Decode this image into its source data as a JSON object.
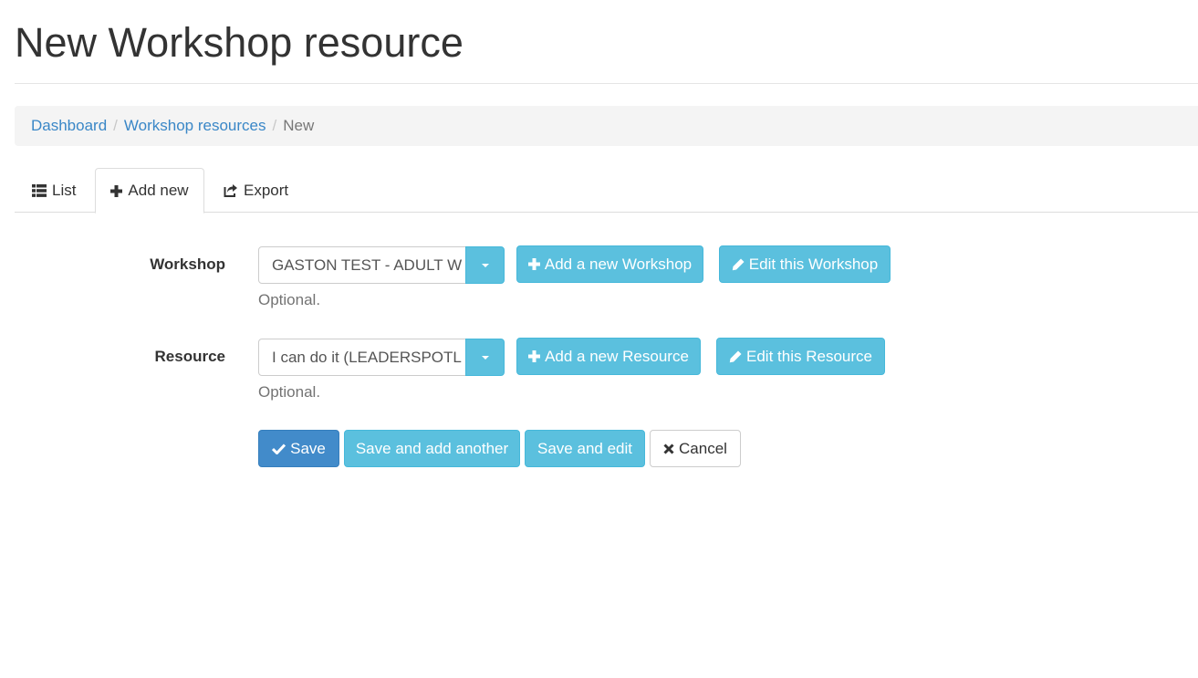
{
  "page": {
    "title": "New Workshop resource"
  },
  "breadcrumb": {
    "items": [
      {
        "label": "Dashboard"
      },
      {
        "label": "Workshop resources"
      },
      {
        "label": "New"
      }
    ],
    "separator": "/"
  },
  "tabs": [
    {
      "label": "List",
      "icon": "list-icon"
    },
    {
      "label": "Add new",
      "icon": "plus-icon",
      "active": true
    },
    {
      "label": "Export",
      "icon": "share-icon"
    }
  ],
  "form": {
    "workshop": {
      "label": "Workshop",
      "value": "GASTON TEST - ADULT W",
      "help": "Optional.",
      "add_label": "Add a new Workshop",
      "edit_label": "Edit this Workshop"
    },
    "resource": {
      "label": "Resource",
      "value": "I can do it (LEADERSPOTL",
      "help": "Optional.",
      "add_label": "Add a new Resource",
      "edit_label": "Edit this Resource"
    }
  },
  "actions": {
    "save": "Save",
    "save_add_another": "Save and add another",
    "save_edit": "Save and edit",
    "cancel": "Cancel"
  },
  "colors": {
    "primary": "#428bca",
    "info": "#5bc0de",
    "link": "#3a87c7"
  }
}
